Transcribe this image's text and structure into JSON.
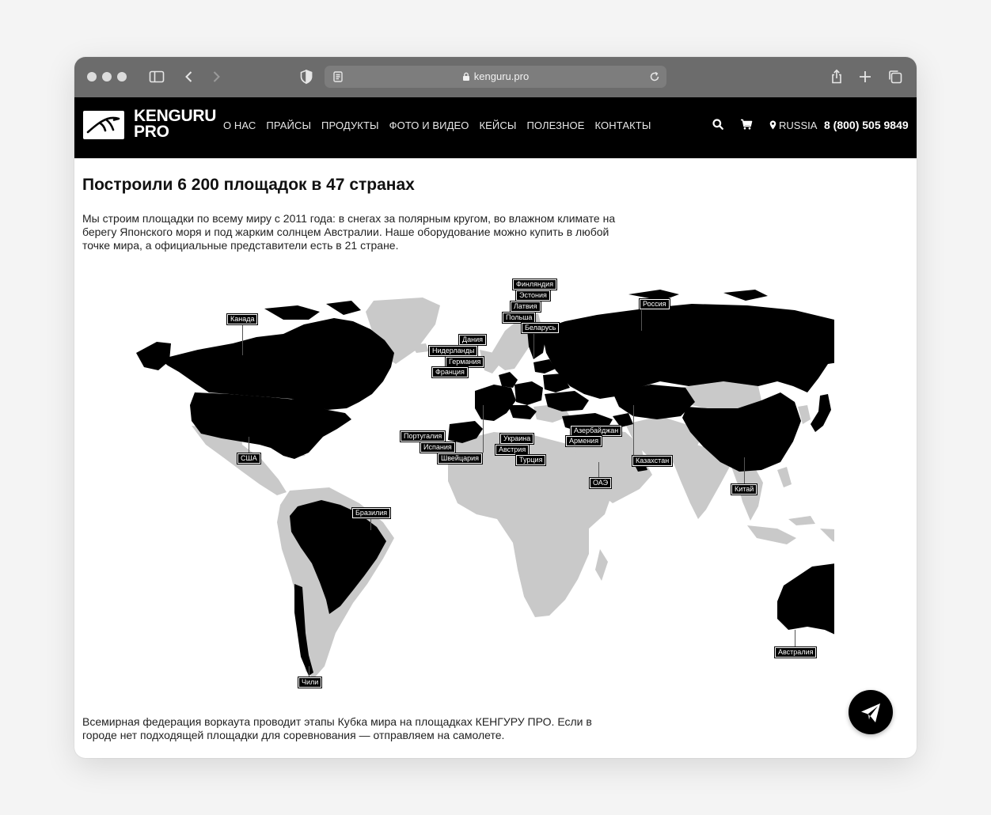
{
  "browser": {
    "url": "kenguru.pro"
  },
  "site": {
    "logo_line1": "KENGURU",
    "logo_line2": "PRO",
    "nav": [
      "О НАС",
      "ПРАЙСЫ",
      "ПРОДУКТЫ",
      "ФОТО И ВИДЕО",
      "КЕЙСЫ",
      "ПОЛЕЗНОЕ",
      "КОНТАКТЫ"
    ],
    "region": "RUSSIA",
    "phone": "8 (800) 505 9849"
  },
  "content": {
    "heading": "Построили 6 200 площадок в 47 странах",
    "intro": "Мы строим площадки по всему миру с 2011 года: в снегах за полярным кругом, во влажном климате на берегу Японского моря и под жарким солнцем Австралии. Наше оборудование можно купить в любой точке мира, а официальные представители есть в 21 стране.",
    "footnote": "Всемирная федерация воркаута проводит этапы Кубка мира на площадках КЕНГУРУ ПРО. Если в городе нет подходящей площадки для соревнования — отправляем на самолете."
  },
  "map": {
    "land_color": "#c9c9c9",
    "highlight_color": "#000000",
    "countries": [
      "Финляндия",
      "Эстония",
      "Латвия",
      "Польша",
      "Беларусь",
      "Россия",
      "Канада",
      "Дания",
      "Нидерланды",
      "Германия",
      "Франция",
      "Португалия",
      "Испания",
      "Швейцария",
      "Украина",
      "Австрия",
      "Турция",
      "Азербайджан",
      "Армения",
      "Казахстан",
      "США",
      "ОАЭ",
      "Китай",
      "Бразилия",
      "Австралия",
      "Чили"
    ]
  },
  "colors": {
    "chrome": "#6c6c6c",
    "header": "#000000",
    "accent": "#000000"
  }
}
